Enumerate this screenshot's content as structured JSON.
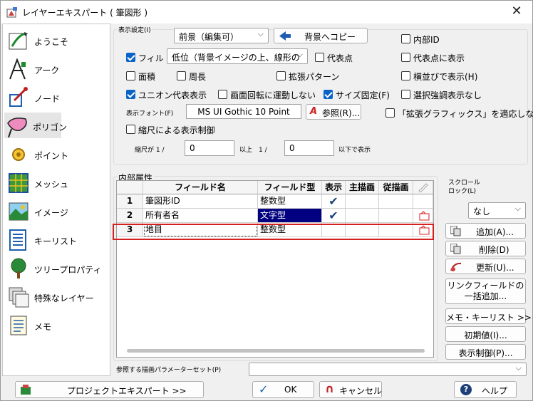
{
  "window": {
    "title": "レイヤーエキスパート ( 筆図形 )",
    "close": "✕"
  },
  "sidebar": {
    "items": [
      {
        "label": "ようこそ",
        "icon": "welcome-icon"
      },
      {
        "label": "アーク",
        "icon": "arc-icon"
      },
      {
        "label": "ノード",
        "icon": "node-icon"
      },
      {
        "label": "ポリゴン",
        "icon": "polygon-icon"
      },
      {
        "label": "ポイント",
        "icon": "point-icon"
      },
      {
        "label": "メッシュ",
        "icon": "mesh-icon"
      },
      {
        "label": "イメージ",
        "icon": "image-icon"
      },
      {
        "label": "キーリスト",
        "icon": "keylist-icon"
      },
      {
        "label": "ツリープロパティ",
        "icon": "tree-icon"
      },
      {
        "label": "特殊なレイヤー",
        "icon": "special-layer-icon"
      },
      {
        "label": "メモ",
        "icon": "memo-icon"
      }
    ],
    "selected": "ポリゴン"
  },
  "display": {
    "group_label": "表示設定(I)",
    "layer_select": "前景（編集可）",
    "copy_back_button": "背景へコピー",
    "fill_label": "フィル",
    "fill_select": "低位（背景イメージの上、線形の",
    "area_label": "面積",
    "perimeter_label": "周長",
    "extended_pattern_label": "拡張パターン",
    "union_label": "ユニオン代表表示",
    "rotate_label": "画面回転に運動しない",
    "size_fixed_label": "サイズ固定(F)",
    "font_label": "表示フォント(F)",
    "font_value": "MS UI Gothic 10 Point",
    "ref_button": "参照(R)...",
    "scale_control_label": "縮尺による表示制御",
    "scale_from_label": "縮尺が 1 /",
    "scale_from_value": "0",
    "scale_mid_label": "以上　1 /",
    "scale_to_value": "0",
    "scale_to_label": "以下で表示",
    "internal_id_label": "内部ID",
    "rep_point_label": "代表点",
    "rep_point_display_label": "代表点に表示",
    "sideways_label": "横並びで表示(H)",
    "select_emphasis_label": "選択強調表示なし",
    "ext_graphics_label": "「拡張グラフィックス」を適応しない",
    "fill_checked": true,
    "union_checked": true,
    "size_fixed_checked": true
  },
  "attributes": {
    "group_label": "内部属性",
    "columns": [
      "フィールド名",
      "フィールド型",
      "表示",
      "主描画",
      "従描画"
    ],
    "rows": [
      {
        "num": "1",
        "name": "筆図形ID",
        "type": "整数型",
        "show": "✔"
      },
      {
        "num": "2",
        "name": "所有者名",
        "type": "文字型",
        "show": "✔"
      },
      {
        "num": "3",
        "name": "地目",
        "type": "整数型",
        "show": ""
      }
    ]
  },
  "scroll_lock": {
    "label": "スクロール\nロック(L)",
    "value": "なし"
  },
  "right_buttons": {
    "add": "追加(A)...",
    "delete": "削除(D)",
    "update": "更新(U)...",
    "link_add": "リンクフィールドの\n一括追加...",
    "memo_keylist": "メモ・キーリスト >>",
    "initial": "初期値(I)...",
    "display_control": "表示制御(P)..."
  },
  "ref_param_label": "参照する描画パラメーターセット(P)",
  "footer": {
    "project": "プロジェクトエキスパート >>",
    "ok": "OK",
    "cancel": "キャンセル",
    "help": "ヘルプ"
  },
  "colors": {
    "accent": "#0a64c8",
    "highlight_row": "#d42020",
    "selected_cell": "#000080"
  }
}
